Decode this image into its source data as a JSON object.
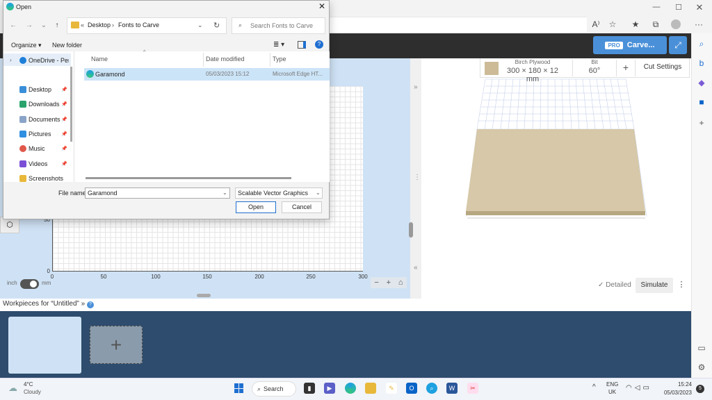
{
  "browser": {
    "window_min": "—",
    "window_max": "☐",
    "window_close": "✕",
    "toolbar_icons": [
      "read-aloud",
      "favorite-add",
      "favorites",
      "collections",
      "profile",
      "more"
    ]
  },
  "app": {
    "carve_label": "Carve...",
    "pro_badge": "PRO",
    "material_name": "Birch Plywood",
    "material_dims": "300 × 180 × 12 mm",
    "bit_label": "Bit",
    "bit_angle": "60°",
    "cut_settings": "Cut Settings",
    "detailed_label": "Detailed",
    "simulate_label": "Simulate",
    "unit_inch": "inch",
    "unit_mm": "mm",
    "x_ticks": [
      "0",
      "50",
      "100",
      "150",
      "200",
      "250",
      "300"
    ],
    "y_ticks": [
      "50",
      "0"
    ],
    "workpieces_title": "Workpieces for “Untitled”"
  },
  "dialog": {
    "title": "Open",
    "breadcrumb_sep": "«",
    "breadcrumb_desktop": "Desktop",
    "breadcrumb_folder": "Fonts to Carve",
    "search_placeholder": "Search Fonts to Carve",
    "organize": "Organize ▾",
    "new_folder": "New folder",
    "nav_items": [
      {
        "label": "OneDrive - Perso",
        "icon": "cloud-icon"
      },
      {
        "label": "Desktop",
        "icon": "desktop-icon"
      },
      {
        "label": "Downloads",
        "icon": "download-icon"
      },
      {
        "label": "Documents",
        "icon": "document-icon"
      },
      {
        "label": "Pictures",
        "icon": "picture-icon"
      },
      {
        "label": "Music",
        "icon": "music-icon"
      },
      {
        "label": "Videos",
        "icon": "video-icon"
      },
      {
        "label": "Screenshots",
        "icon": "folder-icon"
      }
    ],
    "columns": [
      "Name",
      "Date modified",
      "Type"
    ],
    "files": [
      {
        "name": "Garamond",
        "date": "05/03/2023 15:12",
        "type": "Microsoft Edge HT..."
      }
    ],
    "file_name_label": "File name:",
    "file_name_value": "Garamond",
    "file_type_value": "Scalable Vector Graphics",
    "open_label": "Open",
    "cancel_label": "Cancel"
  },
  "taskbar": {
    "temp": "4°C",
    "condition": "Cloudy",
    "search_label": "Search",
    "lang1": "ENG",
    "lang2": "UK",
    "time": "15:24",
    "date": "05/03/2023",
    "notifications": "5"
  },
  "colors": {
    "accent": "#4a90d9",
    "app_header": "#2e2e2e",
    "workpiece_strip": "#2e4c6d",
    "selection": "#cce4f7"
  }
}
